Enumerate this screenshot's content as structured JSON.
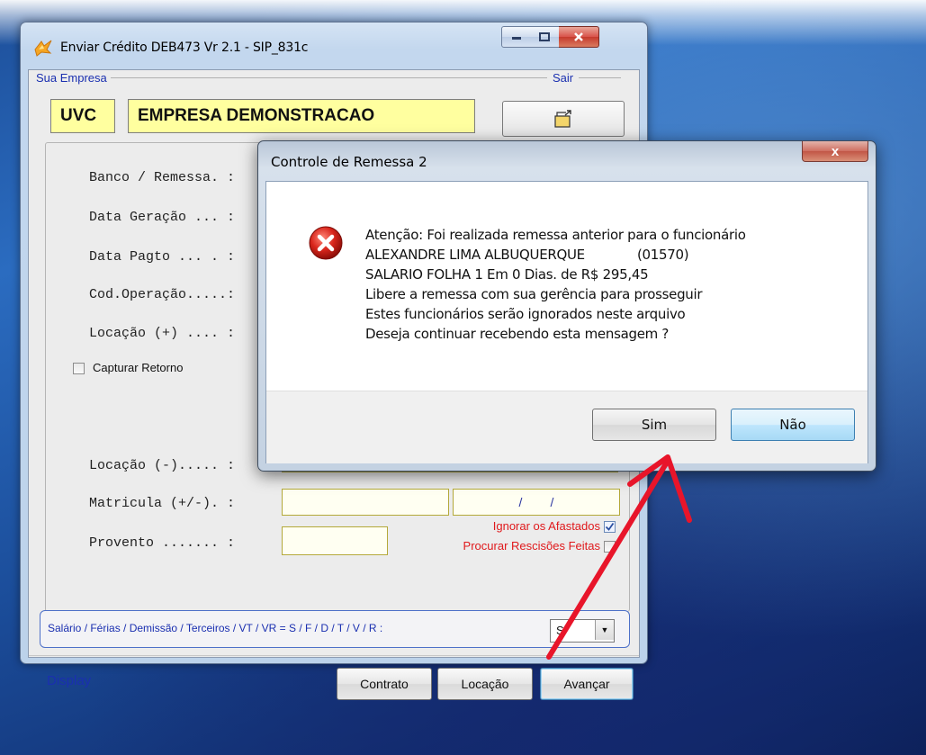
{
  "window": {
    "title": "Enviar Crédito DEB473 Vr 2.1 - SIP_831c",
    "company_group_label": "Sua Empresa",
    "exit_label": "Sair",
    "company_code": "UVC",
    "company_name": "EMPRESA DEMONSTRACAO"
  },
  "form": {
    "banco_label": "Banco / Remessa. :",
    "data_geracao_label": "Data Geração ... :",
    "data_pagto_label": "Data Pagto ... . :",
    "cod_operacao_label": "Cod.Operação.....:",
    "locacao_plus_label": "Locação (+) .... :",
    "capturar_retorno_label": "Capturar Retorno",
    "locacao_minus_label": "Locação (-)..... :",
    "matricula_label": "Matricula (+/-). :",
    "provento_label": "Provento ....... :",
    "date_placeholder": "/        /",
    "ignorar_afastados_label": "Ignorar os Afastados",
    "ignorar_afastados_checked": true,
    "procurar_rescisoes_label": "Procurar Rescisões Feitas",
    "procurar_rescisoes_checked": false,
    "tipo_label": "Salário / Férias / Demissão / Terceiros / VT / VR = S / F / D / T  / V / R  :",
    "tipo_value": "S"
  },
  "footer": {
    "display_label": "Display",
    "contrato_label": "Contrato",
    "locacao_label": "Locação",
    "avancar_label": "Avançar"
  },
  "dialog": {
    "title": "Controle de Remessa 2",
    "message_lines": [
      "Atenção: Foi realizada remessa anterior para o funcionário",
      "ALEXANDRE LIMA ALBUQUERQUE             (01570)",
      "SALARIO FOLHA 1 Em 0 Dias. de R$ 295,45",
      "Libere a remessa com sua gerência para prosseguir",
      "Estes funcionários serão ignorados neste arquivo",
      "Deseja continuar recebendo esta mensagem ?"
    ],
    "yes_label": "Sim",
    "no_label": "Não",
    "close_glyph": "x"
  },
  "colors": {
    "label_blue": "#1a2fb0",
    "warning_red": "#e0191c",
    "highlight_yellow": "#ffff9f",
    "annotation_arrow": "#e8152a"
  }
}
